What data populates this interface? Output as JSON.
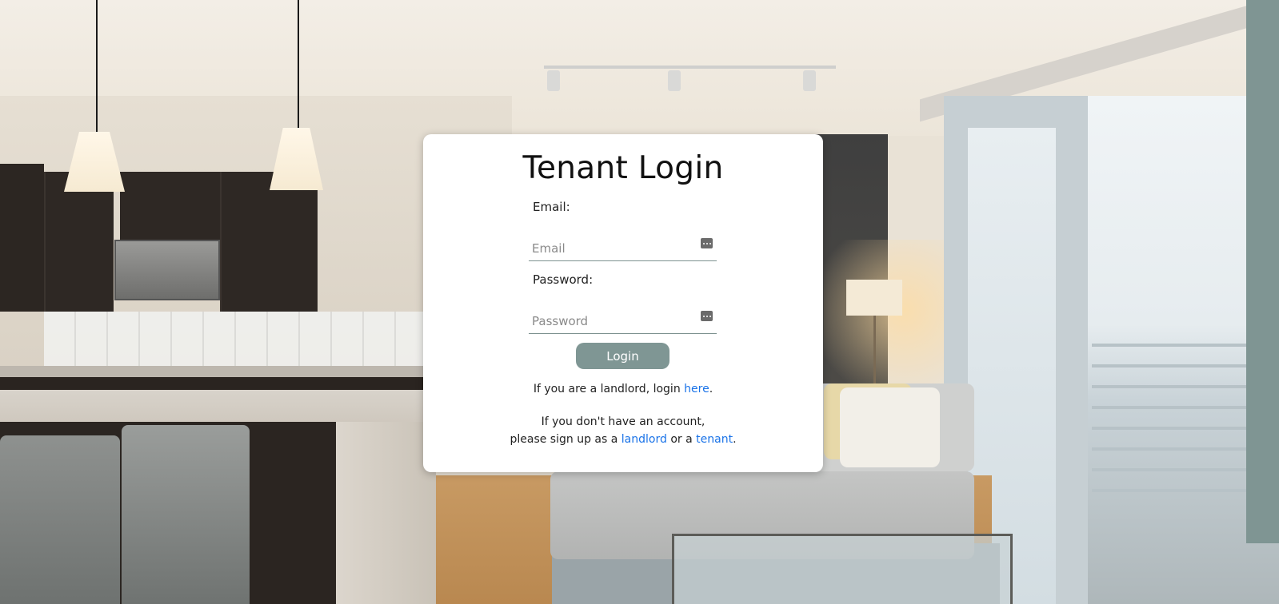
{
  "card": {
    "title": "Tenant Login",
    "email_label": "Email:",
    "email_placeholder": "Email",
    "email_value": "",
    "password_label": "Password:",
    "password_placeholder": "Password",
    "password_value": "",
    "login_button": "Login"
  },
  "landlord_line": {
    "prefix": "If you are a landlord, login ",
    "link": "here",
    "suffix": "."
  },
  "signup": {
    "line1": "If you don't have an account,",
    "prefix": "please sign up as a ",
    "landlord_link": "landlord",
    "middle": " or a ",
    "tenant_link": "tenant",
    "suffix": "."
  },
  "icons": {
    "field_icon": "password-manager-key-icon"
  },
  "colors": {
    "button": "#7f9694",
    "link": "#1a73e8",
    "field_underline": "#7d9290",
    "card_bg": "#ffffff"
  }
}
